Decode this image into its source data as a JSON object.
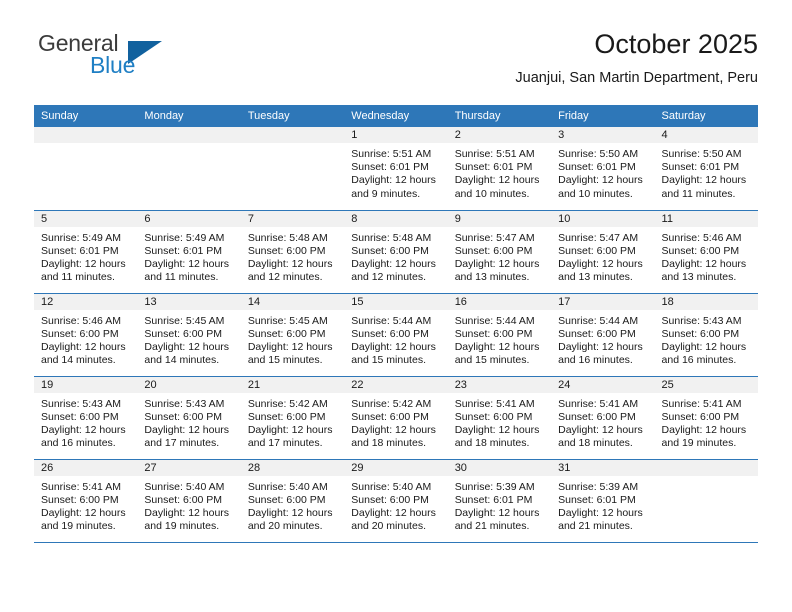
{
  "brand": {
    "name_part1": "General",
    "name_part2": "Blue",
    "triangle_color": "#11619e",
    "blue_color": "#1f7fc4"
  },
  "header": {
    "title": "October 2025",
    "subtitle": "Juanjui, San Martin Department, Peru"
  },
  "theme": {
    "header_bg": "#2e77b8",
    "daynum_bg": "#f1f1f1",
    "row_border": "#2e77b8"
  },
  "weekday_headers": [
    "Sunday",
    "Monday",
    "Tuesday",
    "Wednesday",
    "Thursday",
    "Friday",
    "Saturday"
  ],
  "weeks": [
    [
      {
        "day": "",
        "sunrise": "",
        "sunset": "",
        "daylight_line1": "",
        "daylight_line2": "",
        "empty": true
      },
      {
        "day": "",
        "sunrise": "",
        "sunset": "",
        "daylight_line1": "",
        "daylight_line2": "",
        "empty": true
      },
      {
        "day": "",
        "sunrise": "",
        "sunset": "",
        "daylight_line1": "",
        "daylight_line2": "",
        "empty": true
      },
      {
        "day": "1",
        "sunrise": "Sunrise: 5:51 AM",
        "sunset": "Sunset: 6:01 PM",
        "daylight_line1": "Daylight: 12 hours",
        "daylight_line2": "and 9 minutes.",
        "empty": false
      },
      {
        "day": "2",
        "sunrise": "Sunrise: 5:51 AM",
        "sunset": "Sunset: 6:01 PM",
        "daylight_line1": "Daylight: 12 hours",
        "daylight_line2": "and 10 minutes.",
        "empty": false
      },
      {
        "day": "3",
        "sunrise": "Sunrise: 5:50 AM",
        "sunset": "Sunset: 6:01 PM",
        "daylight_line1": "Daylight: 12 hours",
        "daylight_line2": "and 10 minutes.",
        "empty": false
      },
      {
        "day": "4",
        "sunrise": "Sunrise: 5:50 AM",
        "sunset": "Sunset: 6:01 PM",
        "daylight_line1": "Daylight: 12 hours",
        "daylight_line2": "and 11 minutes.",
        "empty": false
      }
    ],
    [
      {
        "day": "5",
        "sunrise": "Sunrise: 5:49 AM",
        "sunset": "Sunset: 6:01 PM",
        "daylight_line1": "Daylight: 12 hours",
        "daylight_line2": "and 11 minutes.",
        "empty": false
      },
      {
        "day": "6",
        "sunrise": "Sunrise: 5:49 AM",
        "sunset": "Sunset: 6:01 PM",
        "daylight_line1": "Daylight: 12 hours",
        "daylight_line2": "and 11 minutes.",
        "empty": false
      },
      {
        "day": "7",
        "sunrise": "Sunrise: 5:48 AM",
        "sunset": "Sunset: 6:00 PM",
        "daylight_line1": "Daylight: 12 hours",
        "daylight_line2": "and 12 minutes.",
        "empty": false
      },
      {
        "day": "8",
        "sunrise": "Sunrise: 5:48 AM",
        "sunset": "Sunset: 6:00 PM",
        "daylight_line1": "Daylight: 12 hours",
        "daylight_line2": "and 12 minutes.",
        "empty": false
      },
      {
        "day": "9",
        "sunrise": "Sunrise: 5:47 AM",
        "sunset": "Sunset: 6:00 PM",
        "daylight_line1": "Daylight: 12 hours",
        "daylight_line2": "and 13 minutes.",
        "empty": false
      },
      {
        "day": "10",
        "sunrise": "Sunrise: 5:47 AM",
        "sunset": "Sunset: 6:00 PM",
        "daylight_line1": "Daylight: 12 hours",
        "daylight_line2": "and 13 minutes.",
        "empty": false
      },
      {
        "day": "11",
        "sunrise": "Sunrise: 5:46 AM",
        "sunset": "Sunset: 6:00 PM",
        "daylight_line1": "Daylight: 12 hours",
        "daylight_line2": "and 13 minutes.",
        "empty": false
      }
    ],
    [
      {
        "day": "12",
        "sunrise": "Sunrise: 5:46 AM",
        "sunset": "Sunset: 6:00 PM",
        "daylight_line1": "Daylight: 12 hours",
        "daylight_line2": "and 14 minutes.",
        "empty": false
      },
      {
        "day": "13",
        "sunrise": "Sunrise: 5:45 AM",
        "sunset": "Sunset: 6:00 PM",
        "daylight_line1": "Daylight: 12 hours",
        "daylight_line2": "and 14 minutes.",
        "empty": false
      },
      {
        "day": "14",
        "sunrise": "Sunrise: 5:45 AM",
        "sunset": "Sunset: 6:00 PM",
        "daylight_line1": "Daylight: 12 hours",
        "daylight_line2": "and 15 minutes.",
        "empty": false
      },
      {
        "day": "15",
        "sunrise": "Sunrise: 5:44 AM",
        "sunset": "Sunset: 6:00 PM",
        "daylight_line1": "Daylight: 12 hours",
        "daylight_line2": "and 15 minutes.",
        "empty": false
      },
      {
        "day": "16",
        "sunrise": "Sunrise: 5:44 AM",
        "sunset": "Sunset: 6:00 PM",
        "daylight_line1": "Daylight: 12 hours",
        "daylight_line2": "and 15 minutes.",
        "empty": false
      },
      {
        "day": "17",
        "sunrise": "Sunrise: 5:44 AM",
        "sunset": "Sunset: 6:00 PM",
        "daylight_line1": "Daylight: 12 hours",
        "daylight_line2": "and 16 minutes.",
        "empty": false
      },
      {
        "day": "18",
        "sunrise": "Sunrise: 5:43 AM",
        "sunset": "Sunset: 6:00 PM",
        "daylight_line1": "Daylight: 12 hours",
        "daylight_line2": "and 16 minutes.",
        "empty": false
      }
    ],
    [
      {
        "day": "19",
        "sunrise": "Sunrise: 5:43 AM",
        "sunset": "Sunset: 6:00 PM",
        "daylight_line1": "Daylight: 12 hours",
        "daylight_line2": "and 16 minutes.",
        "empty": false
      },
      {
        "day": "20",
        "sunrise": "Sunrise: 5:43 AM",
        "sunset": "Sunset: 6:00 PM",
        "daylight_line1": "Daylight: 12 hours",
        "daylight_line2": "and 17 minutes.",
        "empty": false
      },
      {
        "day": "21",
        "sunrise": "Sunrise: 5:42 AM",
        "sunset": "Sunset: 6:00 PM",
        "daylight_line1": "Daylight: 12 hours",
        "daylight_line2": "and 17 minutes.",
        "empty": false
      },
      {
        "day": "22",
        "sunrise": "Sunrise: 5:42 AM",
        "sunset": "Sunset: 6:00 PM",
        "daylight_line1": "Daylight: 12 hours",
        "daylight_line2": "and 18 minutes.",
        "empty": false
      },
      {
        "day": "23",
        "sunrise": "Sunrise: 5:41 AM",
        "sunset": "Sunset: 6:00 PM",
        "daylight_line1": "Daylight: 12 hours",
        "daylight_line2": "and 18 minutes.",
        "empty": false
      },
      {
        "day": "24",
        "sunrise": "Sunrise: 5:41 AM",
        "sunset": "Sunset: 6:00 PM",
        "daylight_line1": "Daylight: 12 hours",
        "daylight_line2": "and 18 minutes.",
        "empty": false
      },
      {
        "day": "25",
        "sunrise": "Sunrise: 5:41 AM",
        "sunset": "Sunset: 6:00 PM",
        "daylight_line1": "Daylight: 12 hours",
        "daylight_line2": "and 19 minutes.",
        "empty": false
      }
    ],
    [
      {
        "day": "26",
        "sunrise": "Sunrise: 5:41 AM",
        "sunset": "Sunset: 6:00 PM",
        "daylight_line1": "Daylight: 12 hours",
        "daylight_line2": "and 19 minutes.",
        "empty": false
      },
      {
        "day": "27",
        "sunrise": "Sunrise: 5:40 AM",
        "sunset": "Sunset: 6:00 PM",
        "daylight_line1": "Daylight: 12 hours",
        "daylight_line2": "and 19 minutes.",
        "empty": false
      },
      {
        "day": "28",
        "sunrise": "Sunrise: 5:40 AM",
        "sunset": "Sunset: 6:00 PM",
        "daylight_line1": "Daylight: 12 hours",
        "daylight_line2": "and 20 minutes.",
        "empty": false
      },
      {
        "day": "29",
        "sunrise": "Sunrise: 5:40 AM",
        "sunset": "Sunset: 6:00 PM",
        "daylight_line1": "Daylight: 12 hours",
        "daylight_line2": "and 20 minutes.",
        "empty": false
      },
      {
        "day": "30",
        "sunrise": "Sunrise: 5:39 AM",
        "sunset": "Sunset: 6:01 PM",
        "daylight_line1": "Daylight: 12 hours",
        "daylight_line2": "and 21 minutes.",
        "empty": false
      },
      {
        "day": "31",
        "sunrise": "Sunrise: 5:39 AM",
        "sunset": "Sunset: 6:01 PM",
        "daylight_line1": "Daylight: 12 hours",
        "daylight_line2": "and 21 minutes.",
        "empty": false
      },
      {
        "day": "",
        "sunrise": "",
        "sunset": "",
        "daylight_line1": "",
        "daylight_line2": "",
        "empty": true
      }
    ]
  ]
}
